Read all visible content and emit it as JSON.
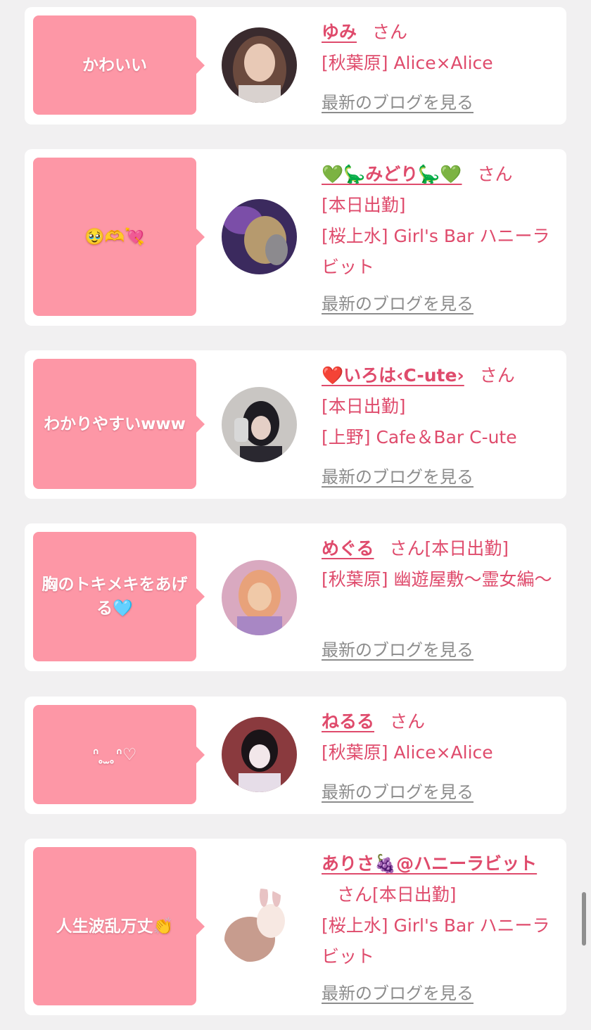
{
  "entries": [
    {
      "comment": "かわいい",
      "name": "ゆみ",
      "honorific": "さん",
      "status": "",
      "shop": "[秋葉原] Alice×Alice",
      "blog_link": "最新のブログを見る",
      "avatar_colors": [
        "#3a2b2e",
        "#e8c9b6"
      ]
    },
    {
      "comment": "🥹🫶💘",
      "name": "💚🦕みどり🦕💚",
      "honorific": "さん",
      "status": "[本日出勤]",
      "shop": "[桜上水] Girl's Bar ハニーラビット",
      "blog_link": "最新のブログを見る",
      "avatar_colors": [
        "#3b2a5e",
        "#b69a6e"
      ]
    },
    {
      "comment": "わかりやすいwww",
      "name": "❤️いろは‹C-ute›",
      "honorific": "さん",
      "status": "[本日出勤]",
      "shop": "[上野] Cafe＆Bar C-ute",
      "blog_link": "最新のブログを見る",
      "avatar_colors": [
        "#c9c6c3",
        "#1e1c22"
      ]
    },
    {
      "comment": "胸のトキメキをあげる🩵",
      "name": "めぐる",
      "honorific": "さん",
      "status": "[本日出勤]",
      "shop": "[秋葉原] 幽遊屋敷〜霊女編〜",
      "blog_link": "最新のブログを見る",
      "avatar_colors": [
        "#d9a9c0",
        "#f0c9a8"
      ]
    },
    {
      "comment": "ᐢ ̥  ̫  ̥ᐢ♡",
      "name": "ねるる",
      "honorific": "さん",
      "status": "",
      "shop": "[秋葉原] Alice×Alice",
      "blog_link": "最新のブログを見る",
      "avatar_colors": [
        "#8a3a3e",
        "#f2e7ea"
      ]
    },
    {
      "comment": "人生波乱万丈👏",
      "name": "ありさ🍇@ハニーラビット",
      "honorific": "さん",
      "status": "[本日出勤]",
      "shop": "[桜上水] Girl's Bar ハニーラビット",
      "blog_link": "最新のブログを見る",
      "avatar_colors": [
        "#e6b3a6",
        "#f7e8e2"
      ]
    }
  ]
}
